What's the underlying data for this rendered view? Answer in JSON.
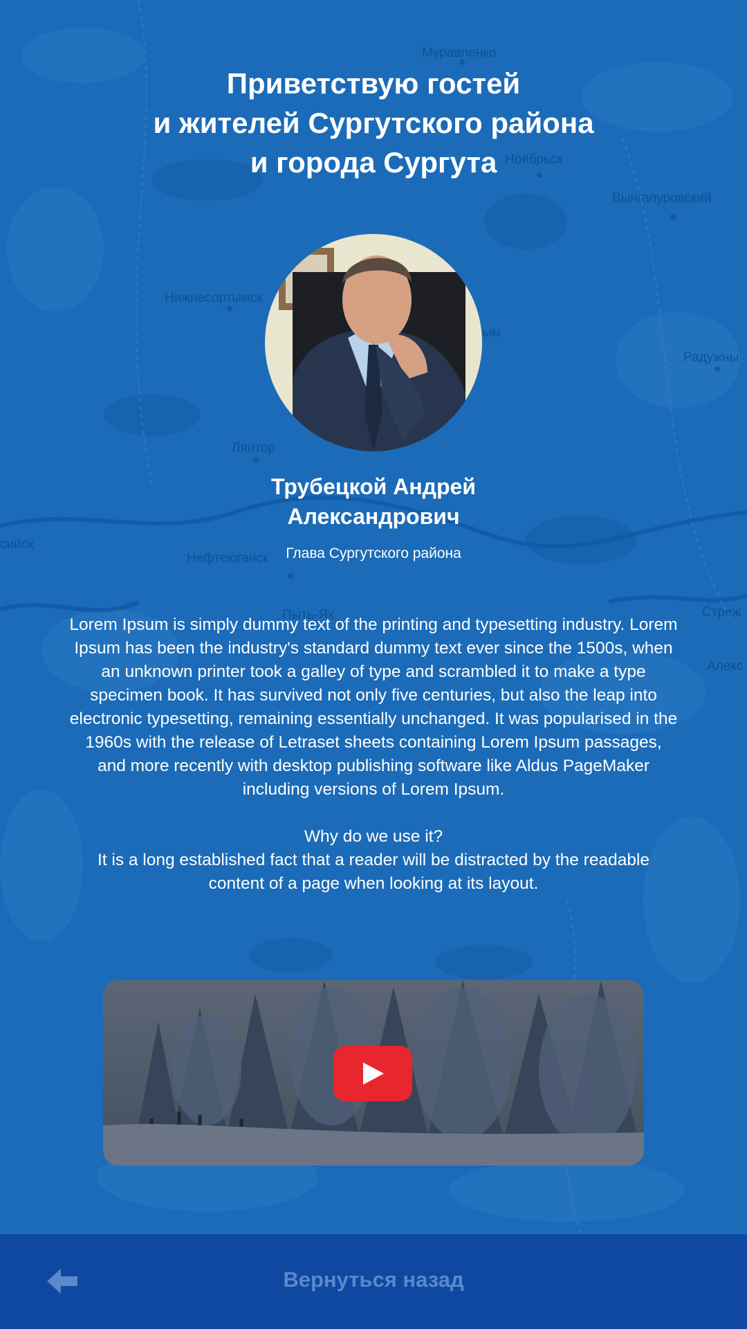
{
  "map": {
    "labels": [
      "Муравленко",
      "Ноябрьск",
      "Вынгапуровский",
      "Нижнесортымск",
      "Радужны",
      "Лянтор",
      "Нефтеюганск",
      "Пыть-Ях",
      "сийск",
      "Стреж",
      "Алекс",
      "ым"
    ]
  },
  "header": {
    "title_lines": [
      "Приветствую гостей",
      "и жителей Сургутского района",
      "и города Сургута"
    ]
  },
  "person": {
    "name_lines": [
      "Трубецкой Андрей",
      "Александрович"
    ],
    "role": "Глава Сургутского района"
  },
  "content": {
    "paragraph": "Lorem Ipsum is simply dummy text of the printing and typesetting industry. Lorem Ipsum has been the industry's standard dummy text ever since the 1500s, when an unknown printer took a galley of type and scrambled it to make a type specimen book. It has survived not only five centuries, but also the leap into electronic typesetting, remaining essentially unchanged. It was popularised in the 1960s with the release of Letraset sheets containing Lorem Ipsum passages, and more recently with desktop publishing software like Aldus PageMaker including versions of Lorem Ipsum.",
    "subheading": "Why do we use it?",
    "paragraph2": "It is a long established fact that a reader will be distracted by the readable content of a page when looking at its layout."
  },
  "video": {
    "play_icon": "youtube-play-icon",
    "play_color": "#e8262d"
  },
  "footer": {
    "back_icon": "arrow-left-icon",
    "back_label": "Вернуться назад",
    "background": "#0e48a0",
    "label_color": "#5a89cc"
  },
  "colors": {
    "background": "#1b6bb8",
    "text": "#ffffff"
  }
}
